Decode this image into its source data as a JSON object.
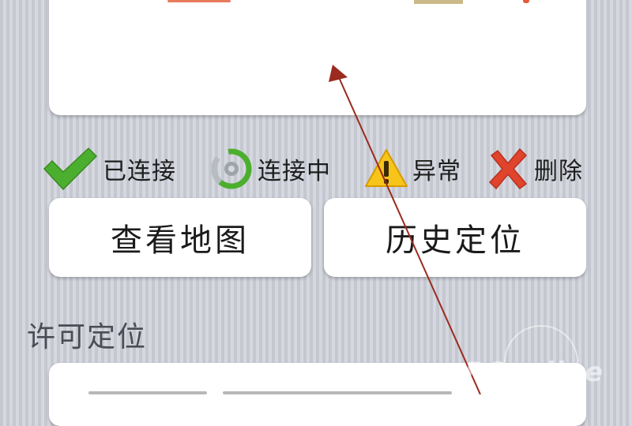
{
  "legend": {
    "connected": {
      "label": "已连接",
      "icon": "check-icon",
      "color": "#4cae2e"
    },
    "connecting": {
      "label": "连接中",
      "icon": "connecting-ring-icon",
      "color": "#4cae2e"
    },
    "abnormal": {
      "label": "异常",
      "icon": "warning-icon",
      "color": "#f0b400"
    },
    "deleted": {
      "label": "删除",
      "icon": "cross-icon",
      "color": "#e0442c"
    }
  },
  "buttons": {
    "view_map": "查看地图",
    "history_location": "历史定位"
  },
  "section": {
    "title": "许可定位"
  },
  "watermark": {
    "text": "PConline"
  },
  "annotation": {
    "arrow_color": "#9b2a1f"
  }
}
